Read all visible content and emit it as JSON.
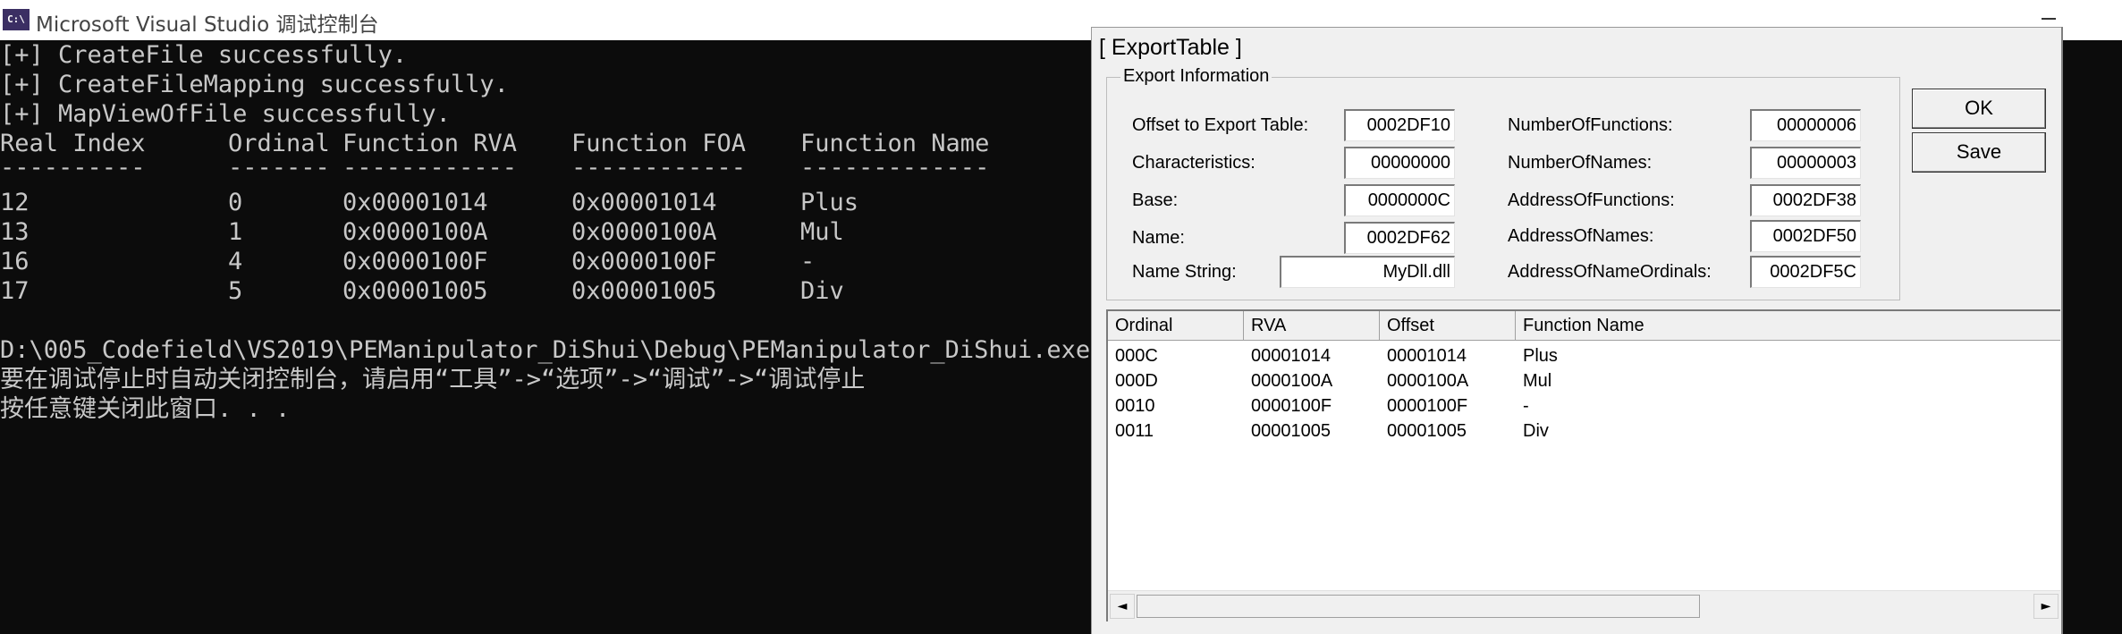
{
  "console_window": {
    "icon_label": "C:\\",
    "title": "Microsoft Visual Studio 调试控制台",
    "lines": [
      "[+] CreateFile successfully.",
      "[+] CreateFileMapping successfully.",
      "[+] MapViewOfFile successfully."
    ],
    "table_headers": [
      "Real Index",
      "Ordinal",
      "Function RVA",
      "Function FOA",
      "Function Name"
    ],
    "table_separators": [
      "----------",
      "-------",
      "------------",
      "------------",
      "-------------"
    ],
    "table_rows": [
      [
        "12",
        "0",
        "0x00001014",
        "0x00001014",
        "Plus"
      ],
      [
        "13",
        "1",
        "0x0000100A",
        "0x0000100A",
        "Mul"
      ],
      [
        "16",
        "4",
        "0x0000100F",
        "0x0000100F",
        "-"
      ],
      [
        "17",
        "5",
        "0x00001005",
        "0x00001005",
        "Div"
      ]
    ],
    "exit_path": "D:\\005_Codefield\\VS2019\\PEManipulator_DiShui\\Debug\\PEManipulator_DiShui.exe",
    "auto_close_hint": "要在调试停止时自动关闭控制台，请启用“工具”->“选项”->“调试”->“调试停止",
    "press_key": "按任意键关闭此窗口. . ."
  },
  "dialog": {
    "title": "[ ExportTable ]",
    "group_label": "Export Information",
    "fields_left": [
      {
        "label": "Offset to Export Table:",
        "value": "0002DF10"
      },
      {
        "label": "Characteristics:",
        "value": "00000000"
      },
      {
        "label": "Base:",
        "value": "0000000C"
      },
      {
        "label": "Name:",
        "value": "0002DF62"
      }
    ],
    "name_string": {
      "label": "Name String:",
      "value": "MyDll.dll"
    },
    "fields_right": [
      {
        "label": "NumberOfFunctions:",
        "value": "00000006"
      },
      {
        "label": "NumberOfNames:",
        "value": "00000003"
      },
      {
        "label": "AddressOfFunctions:",
        "value": "0002DF38"
      },
      {
        "label": "AddressOfNames:",
        "value": "0002DF50"
      },
      {
        "label": "AddressOfNameOrdinals:",
        "value": "0002DF5C"
      }
    ],
    "buttons": {
      "ok": "OK",
      "save": "Save"
    },
    "list_headers": [
      "Ordinal",
      "RVA",
      "Offset",
      "Function Name"
    ],
    "list_rows": [
      [
        "000C",
        "00001014",
        "00001014",
        "Plus"
      ],
      [
        "000D",
        "0000100A",
        "0000100A",
        "Mul"
      ],
      [
        "0010",
        "0000100F",
        "0000100F",
        "-"
      ],
      [
        "0011",
        "00001005",
        "00001005",
        "Div"
      ]
    ],
    "scroll_left": "◄",
    "scroll_right": "►"
  }
}
